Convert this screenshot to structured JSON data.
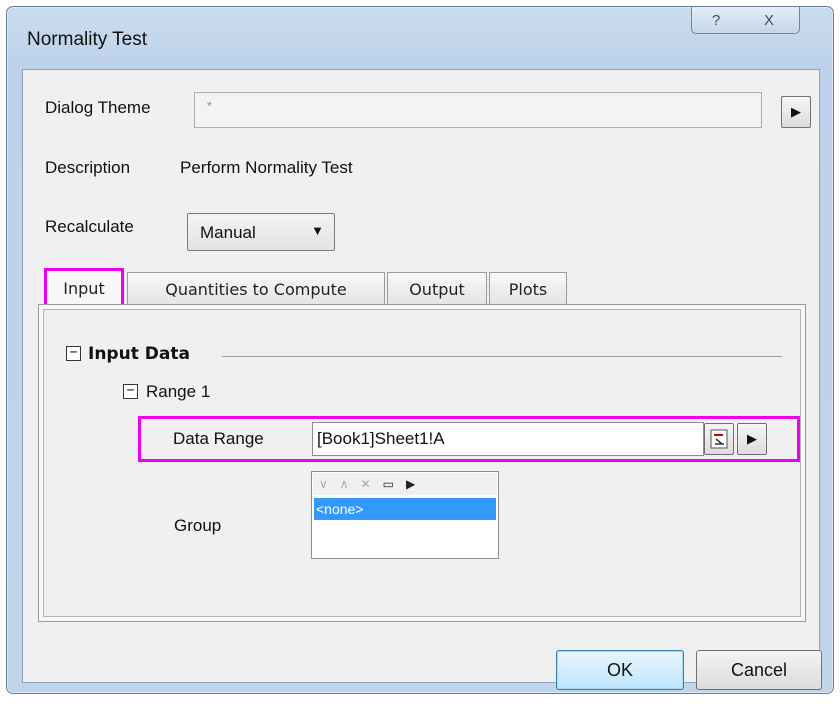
{
  "window": {
    "title": "Normality Test",
    "help_glyph": "?",
    "close_glyph": "X"
  },
  "dialog_theme": {
    "label": "Dialog Theme",
    "value": "*",
    "menu_glyph": "▶"
  },
  "description": {
    "label": "Description",
    "value": "Perform Normality Test"
  },
  "recalculate": {
    "label": "Recalculate",
    "value": "Manual",
    "dropdown_glyph": "▼"
  },
  "tabs": [
    {
      "label": "Input"
    },
    {
      "label": "Quantities to Compute"
    },
    {
      "label": "Output"
    },
    {
      "label": "Plots"
    }
  ],
  "tree": {
    "input_data": {
      "toggle": "−",
      "label": "Input Data"
    },
    "range1": {
      "toggle": "−",
      "label": "Range 1"
    },
    "data_range": {
      "label": "Data Range",
      "value": "[Book1]Sheet1!A",
      "menu_glyph": "▶"
    },
    "group": {
      "label": "Group",
      "toolbar_glyphs": [
        "∨",
        "∧",
        "✕",
        "▭",
        "▶"
      ],
      "selected_item": "<none>"
    }
  },
  "buttons": {
    "ok": "OK",
    "cancel": "Cancel"
  },
  "colors": {
    "highlight": "#ee00ee",
    "selection": "#3399ff"
  }
}
